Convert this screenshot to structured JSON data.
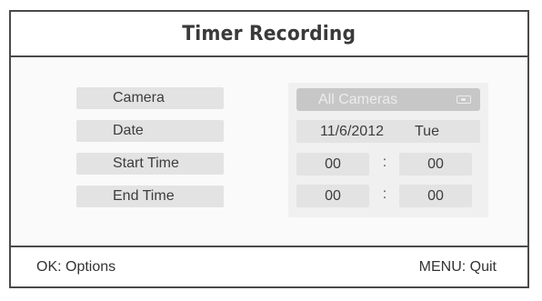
{
  "title": "Timer Recording",
  "fields": {
    "camera_label": "Camera",
    "date_label": "Date",
    "start_time_label": "Start Time",
    "end_time_label": "End Time"
  },
  "values": {
    "camera": "All Cameras",
    "camera_icon": "camera-icon",
    "date": "11/6/2012",
    "day": "Tue",
    "start_hour": "00",
    "start_minute": "00",
    "end_hour": "00",
    "end_minute": "00",
    "separator": ":"
  },
  "footer": {
    "ok_hint": "OK: Options",
    "menu_hint": "MENU: Quit"
  },
  "colors": {
    "border": "#4a4a4a",
    "field_bg": "#e3e3e3",
    "selected_bg": "#c7c7c7",
    "text": "#333333"
  }
}
